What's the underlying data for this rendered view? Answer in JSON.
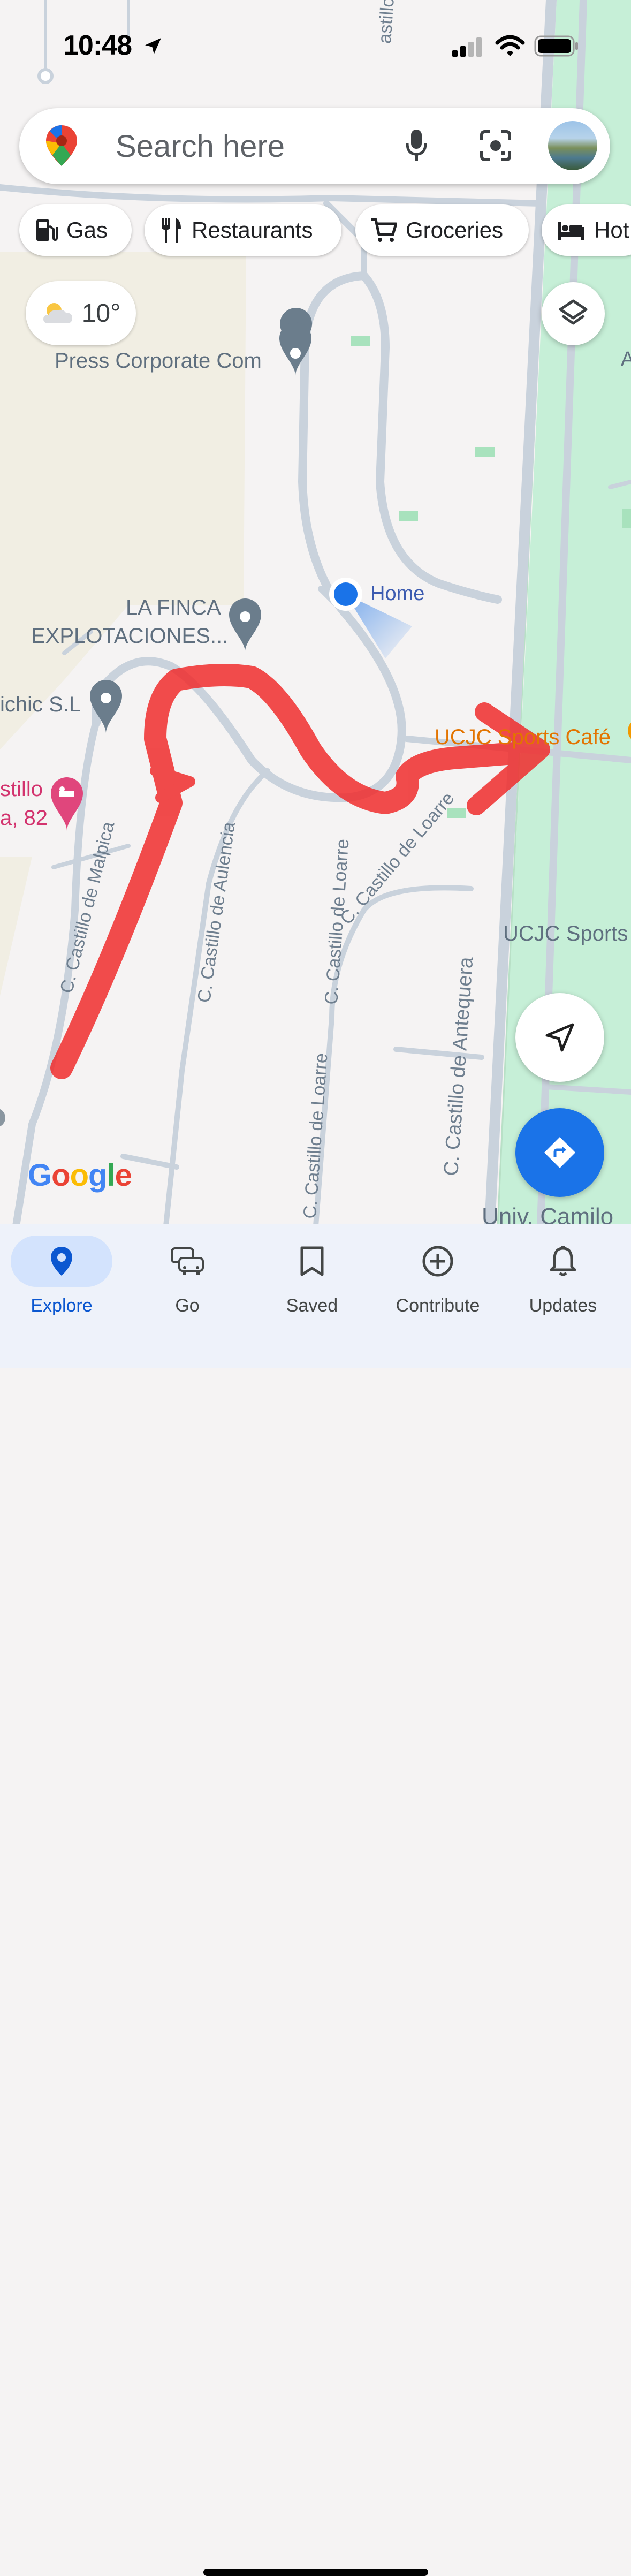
{
  "status_bar": {
    "time": "10:48"
  },
  "search": {
    "placeholder": "Search here"
  },
  "chips": [
    {
      "label": "Gas",
      "icon": "gas-station-icon"
    },
    {
      "label": "Restaurants",
      "icon": "fork-knife-icon"
    },
    {
      "label": "Groceries",
      "icon": "cart-icon"
    },
    {
      "label": "Hot",
      "icon": "bed-icon"
    }
  ],
  "weather": {
    "temperature": "10°",
    "icon": "partly-cloudy-icon"
  },
  "map": {
    "places": {
      "press_corporate": "Press Corporate Com",
      "la_finca_line1": "LA FINCA",
      "la_finca_line2": "EXPLOTACIONES...",
      "ichic": "ichic S.L",
      "stillo_line1": "stillo",
      "stillo_line2": "a, 82",
      "home": "Home",
      "ucjc_cafe": "UCJC Sports Café",
      "ucjc_sports": "UCJC Sports",
      "univ": "Univ. Camilo"
    },
    "streets": {
      "malpica": "C. Castillo de Malpica",
      "aulencia": "C. Castillo de Aulencia",
      "loarre_upper": "C. Castillo de Loarre",
      "loarre_curve": "C. Castillo de Loarre",
      "loarre_lower": "C. Castillo de Loarre",
      "antequera": "C. Castillo de Antequera",
      "top_street": "astillo de Ma"
    },
    "edge_letter": "A",
    "logo": "Google",
    "colors": {
      "park": "#c6efd7",
      "road": "#c7d0da",
      "land": "#f5f3f3",
      "urban": "#f1eee3",
      "poi_orange": "#e37400",
      "poi_pink": "#d3336e",
      "location_blue": "#1a73e8",
      "drawn_arrow": "#f02d2d"
    }
  },
  "nav": [
    {
      "label": "Explore",
      "icon": "pin-icon",
      "active": true
    },
    {
      "label": "Go",
      "icon": "car-icon"
    },
    {
      "label": "Saved",
      "icon": "bookmark-icon"
    },
    {
      "label": "Contribute",
      "icon": "plus-circle-icon"
    },
    {
      "label": "Updates",
      "icon": "bell-icon"
    }
  ]
}
